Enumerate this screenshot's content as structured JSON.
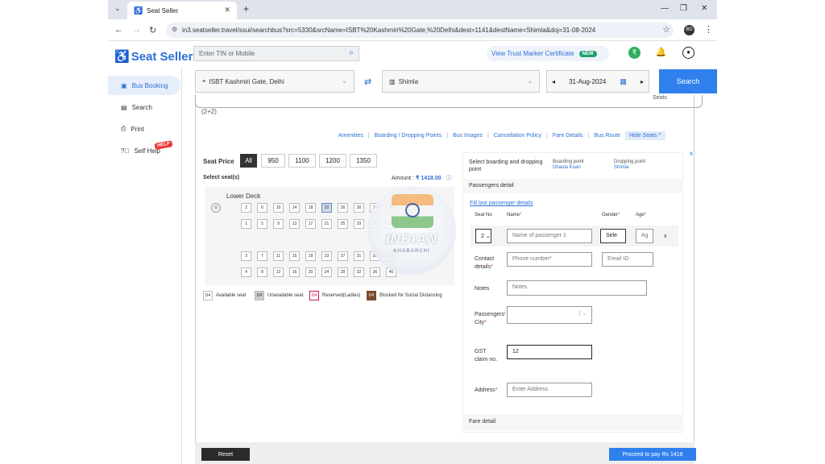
{
  "browser": {
    "tab_title": "Seat Seller",
    "url": "in3.seatseller.travel/ssui/searchbus?src=5330&srcName=ISBT%20Kashmiri%20Gate,%20Delhi&dest=1141&destName=Shimla&doj=31-08-2024",
    "profile_initials": "BD"
  },
  "app": {
    "logo_text": "Seat Seller",
    "tin_placeholder": "Enter TIN or Mobile",
    "trust_label": "View Trust Marker Certificate",
    "trust_badge": "NEW"
  },
  "sidebar": {
    "items": [
      {
        "label": "Bus Booking",
        "icon": "bus-icon"
      },
      {
        "label": "Search",
        "icon": "search-icon"
      },
      {
        "label": "Print",
        "icon": "print-icon"
      },
      {
        "label": "Self Help",
        "icon": "help-icon"
      }
    ],
    "help_badge": "HELP"
  },
  "search": {
    "source": "ISBT Kashmiri Gate, Delhi",
    "destination": "Shimla",
    "date": "31-Aug-2024",
    "button": "Search"
  },
  "bus": {
    "layout_text": "(2+2)",
    "seats_text": "Seats",
    "links": [
      "Amenities",
      "Boarding / Dropping Points",
      "Bus Images",
      "Cancellation Policy",
      "Fare Details",
      "Bus Route"
    ],
    "hide_seats": "Hide Seats ^"
  },
  "seatmap": {
    "price_label": "Seat Price",
    "prices": [
      "All",
      "950",
      "1100",
      "1200",
      "1350"
    ],
    "select_label": "Select seat(s)",
    "amount_label": "Amount :",
    "amount_value": "₹ 1418.00",
    "deck_title": "Lower Deck",
    "row1": [
      "2",
      "6",
      "10",
      "14",
      "18",
      "22",
      "26",
      "30",
      "34"
    ],
    "row2": [
      "1",
      "5",
      "9",
      "13",
      "17",
      "21",
      "25",
      "29",
      "33"
    ],
    "mid": [
      "41",
      "37"
    ],
    "row3": [
      "3",
      "7",
      "11",
      "15",
      "19",
      "23",
      "27",
      "31",
      "35"
    ],
    "row4": [
      "4",
      "8",
      "12",
      "16",
      "20",
      "24",
      "28",
      "32",
      "36",
      "40"
    ],
    "row3_end": "39",
    "row1_end": "38",
    "selected_seat": "22",
    "legend": [
      {
        "code": "D4",
        "label": "Available seat"
      },
      {
        "code": "D4",
        "label": "Unavailable seat"
      },
      {
        "code": "D4",
        "label": "Reserved(Ladies)"
      },
      {
        "code": "D4",
        "label": "Blocked for Social Distancing"
      }
    ]
  },
  "watermark": {
    "line1": "INDIAN",
    "line2": "KHABARCHI"
  },
  "passenger": {
    "bdp_label": "Select boarding and dropping point",
    "boarding_label": "Boarding point",
    "boarding_value": "Dhaula Kuan",
    "dropping_label": "Dropping point",
    "dropping_value": "Shimla",
    "section_title": "Passengers detail",
    "fill_last": "Fill last passenger details",
    "col_seat": "Seat No",
    "col_name": "Name",
    "col_gender": "Gender",
    "col_age": "Age",
    "seat_value": "2",
    "name_placeholder": "Name of passenger 1",
    "gender_value": "Sele",
    "age_placeholder": "Ag",
    "contact_label": "Contact details",
    "phone_placeholder": "Phone number*",
    "email_placeholder": "Email ID",
    "notes_label": "Notes",
    "notes_placeholder": "Notes",
    "city_label": "Passengers' City",
    "gst_label": "GST claim no.",
    "gst_value": "12",
    "address_label": "Address",
    "address_placeholder": "Enter Address",
    "fare_detail": "Fare detail"
  },
  "footer": {
    "reset": "Reset",
    "pay": "Proceed to pay Rs 1418"
  },
  "colors": {
    "accent": "#2f80ed",
    "new_badge": "#1f9e6d"
  }
}
